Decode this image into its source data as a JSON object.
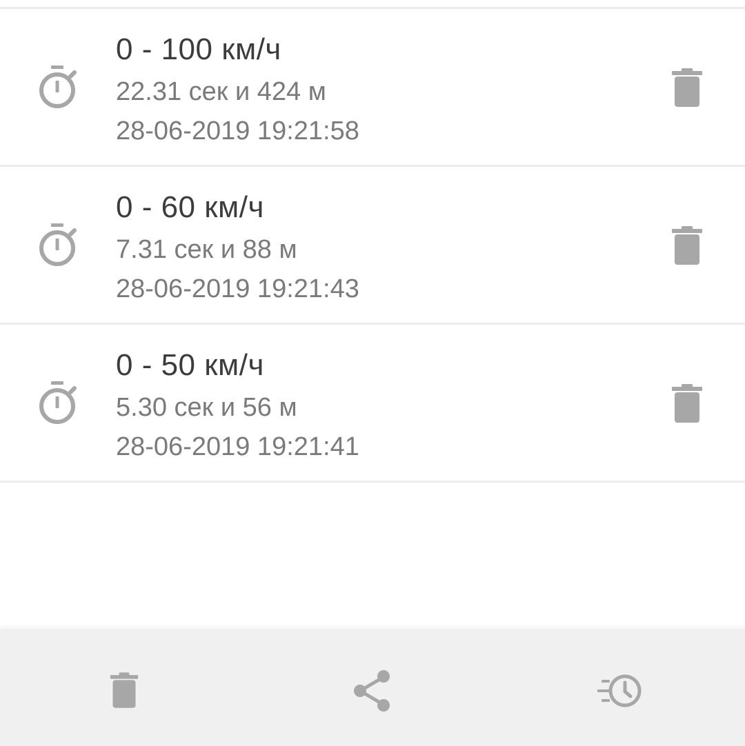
{
  "colors": {
    "icon_gray": "#a7a7a7",
    "title_text": "#3c3c3c",
    "secondary_text": "#7a7a7a",
    "divider": "#ececec",
    "bottom_bar_bg": "#f0f0f0"
  },
  "results": [
    {
      "icon": "stopwatch-icon",
      "title": "0 - 100 км/ч",
      "detail": "22.31 сек и 424 м",
      "timestamp": "28-06-2019 19:21:58",
      "delete_icon": "trash-icon"
    },
    {
      "icon": "stopwatch-icon",
      "title": "0 - 60 км/ч",
      "detail": "7.31 сек и 88 м",
      "timestamp": "28-06-2019 19:21:43",
      "delete_icon": "trash-icon"
    },
    {
      "icon": "stopwatch-icon",
      "title": "0 - 50 км/ч",
      "detail": "5.30 сек и 56 м",
      "timestamp": "28-06-2019 19:21:41",
      "delete_icon": "trash-icon"
    }
  ],
  "bottom_bar": {
    "items": [
      {
        "icon": "trash-icon"
      },
      {
        "icon": "share-icon"
      },
      {
        "icon": "history-icon"
      }
    ]
  }
}
